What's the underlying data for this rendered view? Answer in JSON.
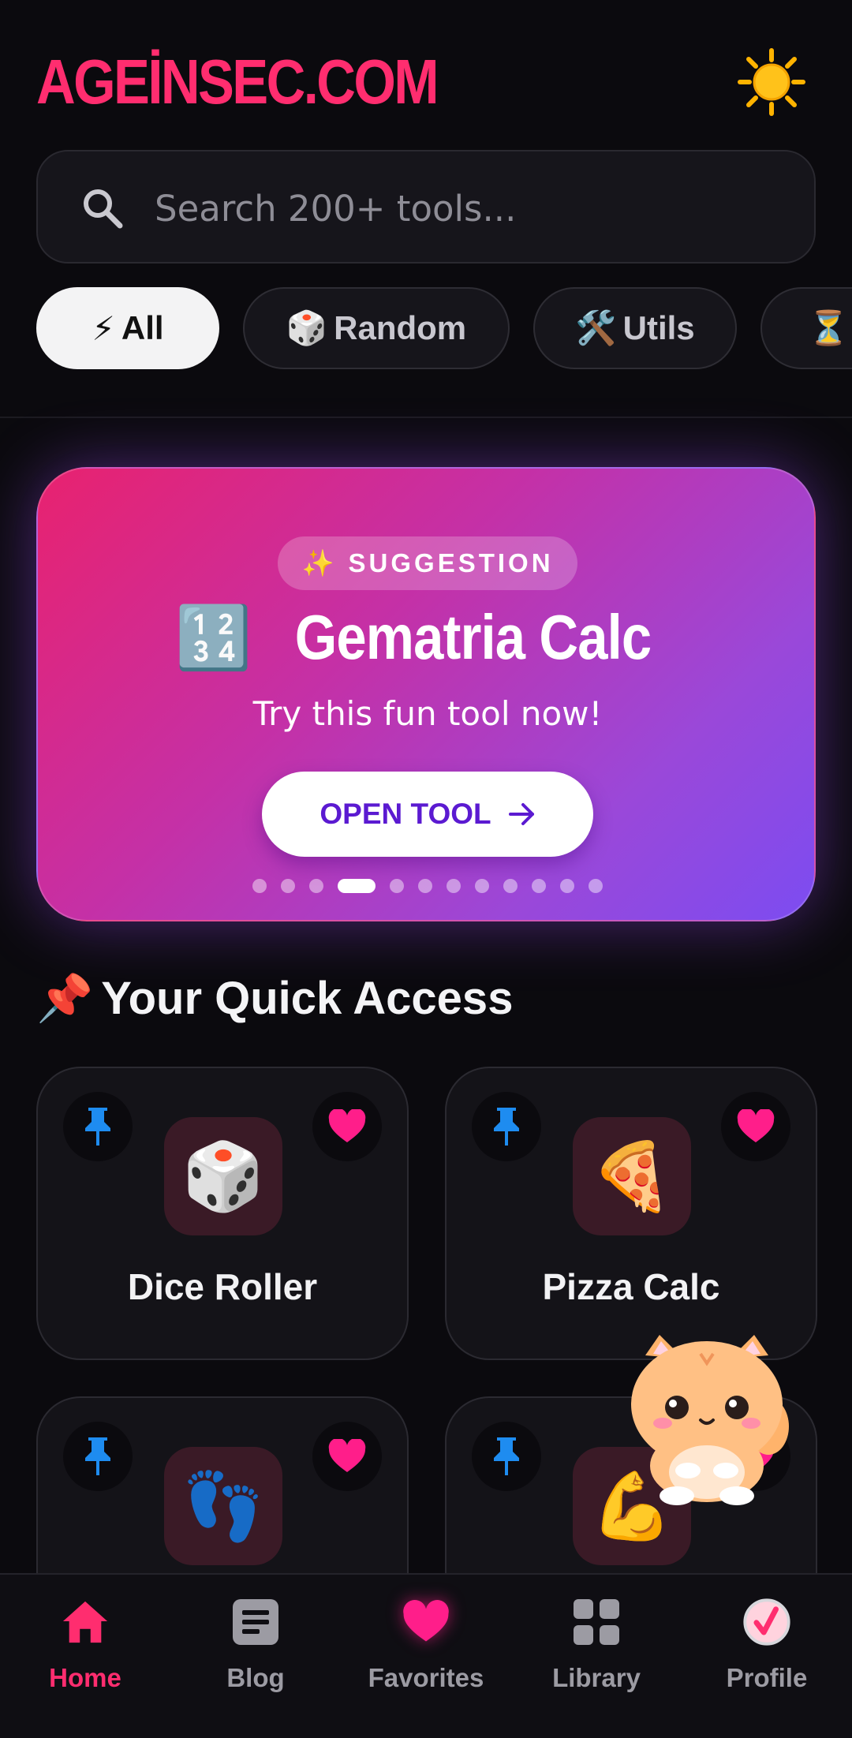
{
  "app": {
    "logo": "AGEİNSEC.COM",
    "theme_icon": "sun-icon"
  },
  "search": {
    "placeholder": "Search 200+ tools..."
  },
  "chips": [
    {
      "emoji": "⚡",
      "label": "All",
      "active": true
    },
    {
      "emoji": "🎲",
      "label": "Random",
      "active": false
    },
    {
      "emoji": "🛠️",
      "label": "Utils",
      "active": false
    },
    {
      "emoji": "⏳",
      "label": "",
      "active": false
    }
  ],
  "banner": {
    "badge_emoji": "✨",
    "badge": "SUGGESTION",
    "title_emoji": "🔢",
    "title": "Gematria Calc",
    "subtitle": "Try this fun tool now!",
    "button_label": "OPEN TOOL",
    "dots_total": 12,
    "dots_active": 4
  },
  "quick_access": {
    "emoji": "📌",
    "title": "Your Quick Access",
    "items": [
      {
        "emoji": "🎲",
        "name": "Dice Roller"
      },
      {
        "emoji": "🍕",
        "name": "Pizza Calc"
      },
      {
        "emoji": "👣",
        "name": ""
      },
      {
        "emoji": "💪",
        "name": ""
      }
    ]
  },
  "nav": {
    "home": "Home",
    "blog": "Blog",
    "favorites": "Favorites",
    "library": "Library",
    "profile": "Profile"
  },
  "colors": {
    "accent": "#ff2d6f",
    "background": "#0b0a0e",
    "card": "#141318",
    "pin_blue": "#1e8cf0"
  }
}
